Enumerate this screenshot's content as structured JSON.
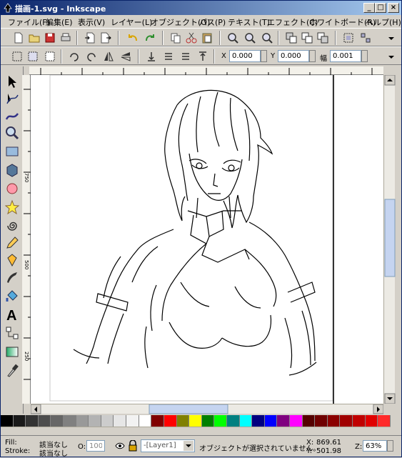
{
  "window": {
    "title": "描画-1.svg - Inkscape",
    "controls": [
      "_",
      "□",
      "×"
    ]
  },
  "menu": [
    "ファイル(F)",
    "編集(E)",
    "表示(V)",
    "レイヤー(L)",
    "オブジェクト(O)",
    "パス(P)",
    "テキスト(T)",
    "エフェクト(C)",
    "ホワイトボード(R)",
    "ヘルプ(H)"
  ],
  "toolcontrols": {
    "x_label": "X",
    "x_value": "0.000",
    "y_label": "Y",
    "y_value": "0.000",
    "w_label": "幅",
    "w_value": "0.001"
  },
  "ruler": {
    "h_ticks": [
      "-250",
      "0",
      "250",
      "500",
      "750"
    ],
    "v_ticks": [
      "750",
      "500",
      "250"
    ]
  },
  "palette": {
    "colors": [
      "#000000",
      "#1a1a1a",
      "#333333",
      "#4d4d4d",
      "#666666",
      "#808080",
      "#999999",
      "#b3b3b3",
      "#cccccc",
      "#e6e6e6",
      "#f2f2f2",
      "#ffffff",
      "#800000",
      "#ff0000",
      "#808000",
      "#ffff00",
      "#008000",
      "#00ff00",
      "#008080",
      "#00ffff",
      "#000080",
      "#0000ff",
      "#800080",
      "#ff00ff",
      "#550000",
      "#6f0000",
      "#8b0000",
      "#a00000",
      "#c00000",
      "#e00000",
      "#ff2a2a"
    ]
  },
  "status": {
    "fill_label": "Fill:",
    "fill_value": "該当なし",
    "stroke_label": "Stroke:",
    "stroke_value": "該当なし",
    "opacity_label": "O:",
    "opacity_value": "100",
    "layer": "-[Layer1]",
    "message": "オブジェクトが選択されていません。",
    "cursor_x_label": "X:",
    "cursor_x": "869.61",
    "cursor_y_label": "Y:",
    "cursor_y": "501.98",
    "zoom_label": "Z:",
    "zoom": "63%"
  }
}
